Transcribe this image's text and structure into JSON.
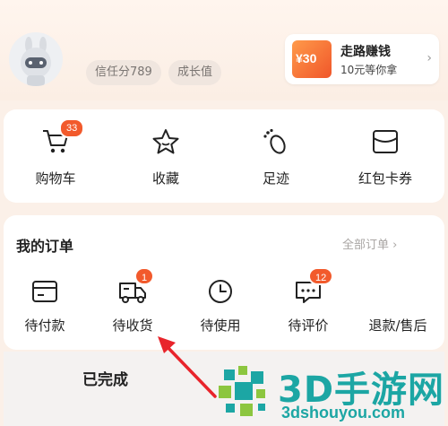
{
  "profile": {
    "trust_score": "信任分789",
    "growth": "成长值"
  },
  "promo": {
    "amount": "¥30",
    "title": "走路赚钱",
    "subtitle": "10元等你拿"
  },
  "quick_links": [
    {
      "label": "购物车",
      "icon": "cart-icon",
      "badge": "33"
    },
    {
      "label": "收藏",
      "icon": "star-icon"
    },
    {
      "label": "足迹",
      "icon": "footprint-icon"
    },
    {
      "label": "红包卡券",
      "icon": "wallet-icon"
    }
  ],
  "orders": {
    "title": "我的订单",
    "view_all": "全部订单 ›",
    "items": [
      {
        "label": "待付款",
        "icon": "card-icon"
      },
      {
        "label": "待收货",
        "icon": "truck-icon",
        "badge": "1"
      },
      {
        "label": "待使用",
        "icon": "clock-icon"
      },
      {
        "label": "待评价",
        "icon": "comment-icon",
        "badge": "12"
      },
      {
        "label": "退款/售后",
        "icon": "refund-icon"
      }
    ]
  },
  "completed": {
    "label": "已完成"
  },
  "watermark": {
    "text": "3D手游网",
    "url": "3dshouyou.com"
  },
  "colors": {
    "accent": "#f25a2c",
    "watermark": "#1ca6a4",
    "arrow": "#e8242b"
  }
}
